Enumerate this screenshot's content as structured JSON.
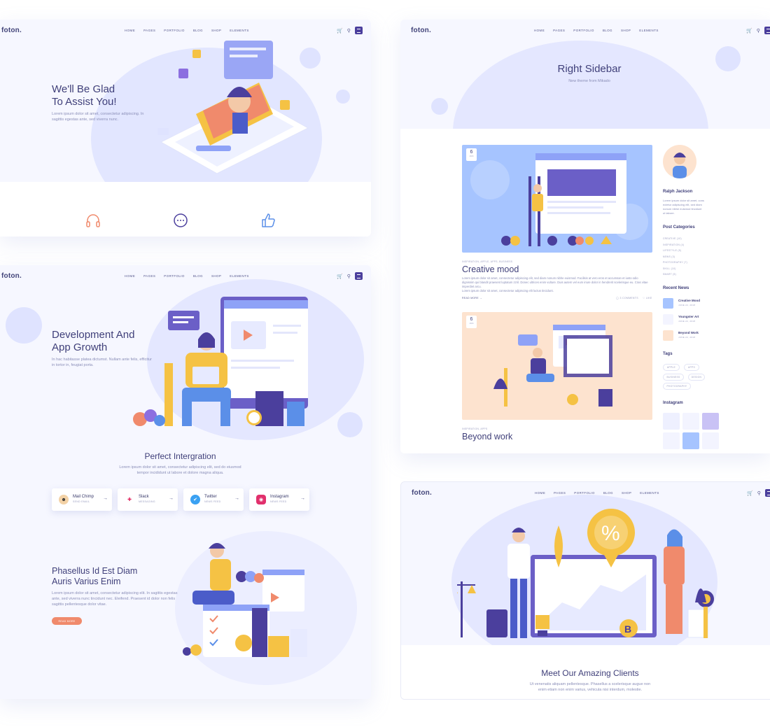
{
  "nav_common": {
    "logo": "foton.",
    "menu": [
      "HOME",
      "PAGES",
      "PORTFOLIO",
      "BLOG",
      "SHOP",
      "ELEMENTS"
    ]
  },
  "card1": {
    "title_line1": "We'll Be Glad",
    "title_line2": "To Assist You!",
    "text_line1": "Lorem ipsum dolor sit amet, consectetur adipiscing. In",
    "text_line2": "sagittis egestas ante, sed viverra nunc.",
    "icons": [
      "headphones-icon",
      "chat-bubble-icon",
      "thumbs-up-icon"
    ],
    "colors": {
      "headphones": "#f08a6c",
      "chat": "#4b3f9d",
      "thumb": "#5b8fe8"
    }
  },
  "card2": {
    "title_line1": "Development And",
    "title_line2": "App Growth",
    "text_line1": "In hac habitasse platea dictumst. Nullam ante felis, efficitur",
    "text_line2": "in tortor in, feugiat porta.",
    "section_title": "Perfect Intergration",
    "section_text1": "Lorem ipsum dolor sit amet, consectetur adipiscing elit, sed do eiusmod",
    "section_text2": "tempor incididunt ut labore et dolore magna aliqua.",
    "integrations": [
      {
        "name": "Mail Chimp",
        "sub": "SEND EMAIL",
        "icon": "mailchimp-icon",
        "color": "#f3d2a6"
      },
      {
        "name": "Slack",
        "sub": "MESSAGING",
        "icon": "slack-icon",
        "color": "#ffffff"
      },
      {
        "name": "Twitter",
        "sub": "NEWS FEED",
        "icon": "twitter-icon",
        "color": "#3aa1f2"
      },
      {
        "name": "Instagram",
        "sub": "NEWS FEED",
        "icon": "instagram-icon",
        "color": "#e1306c"
      }
    ],
    "feature_title1": "Phasellus Id Est Diam",
    "feature_title2": "Auris Varius Enim",
    "feature_text1": "Lorem ipsum dolor sit amet, consectetur adipiscing elit. In sagittis egestas",
    "feature_text2": "ante, sed viverra nunc tincidunt nec. Eleifend. Praesent id dolor non felis",
    "feature_text3": "sagittis pellentesque dolor vitae.",
    "button": "READ MORE"
  },
  "card3": {
    "title": "Right Sidebar",
    "subtitle": "New theme from Mikado",
    "posts": [
      {
        "day": "6",
        "month": "JUN",
        "cats": "INSPIRATION, APPLE, APPS, BUSINESS",
        "title": "Creative mood",
        "text1": "Lorem ipsum dolor sit amet, consectetur adipiscing elit, sed diam nonum nibhe euismod. Facilisis at vero eros et accumsan et iusto odio",
        "text2": "dignissim qui blandit praesent luptatum zzril. Donec ultrices enim vulture. Duis autem vel eum iriure dolor in hendrerit scelerisque eu. Cras vitae imperdiet arcu.",
        "text3": "Lorem ipsum dolor sit amet, consectetur adipiscing elit luctus tincidunt.",
        "read_more": "READ MORE",
        "comments": "3 COMMENTS",
        "likes": "LIKE"
      },
      {
        "day": "6",
        "month": "JUN",
        "cats": "INSPIRATION, APPS",
        "title": "Beyond work"
      }
    ],
    "sidebar": {
      "author": "Ralph Jackson",
      "author_text1": "Lorem ipsum dolor sit amet, cons",
      "author_text2": "ectetur adipiscing elit, sed diam",
      "author_text3": "nonum nibhe euismod tincidunt",
      "author_text4": "ut labore.",
      "cat_heading": "Post Categories",
      "categories": [
        "CREATIVE (10)",
        "INSPIRATION (4)",
        "LIFESTYLE (5)",
        "NEWS (3)",
        "PHOTOGRAPHY (7)",
        "SKILL (10)",
        "SMART (5)"
      ],
      "news_heading": "Recent News",
      "news": [
        {
          "title": "Creative Mood",
          "date": "JUNE 22, 2018"
        },
        {
          "title": "Youngster Art",
          "date": "JUNE 22, 2018"
        },
        {
          "title": "Beyond Work",
          "date": "JUNE 22, 2018"
        }
      ],
      "tags_heading": "Tags",
      "tags": [
        "APPLE",
        "APPS",
        "BUSINESS",
        "DESIGN",
        "PHOTOGRAPHY"
      ],
      "insta_heading": "Instagram"
    }
  },
  "card4": {
    "title": "Meet Our Amazing Clients",
    "text1": "Ut venenatis aliquam pellentesque. Phasellus a scelerisque augue non",
    "text2": "enim etiam non enim varius, vehicula nisi interdum, molestie.",
    "badge": "%",
    "coin": "B"
  },
  "colors": {
    "accent": "#4b3f9d",
    "accent_light": "#6b5fc7",
    "orange": "#f08a6c",
    "yellow": "#f5c244",
    "bg": "#f6f7ff",
    "blob": "#e4e7ff"
  }
}
